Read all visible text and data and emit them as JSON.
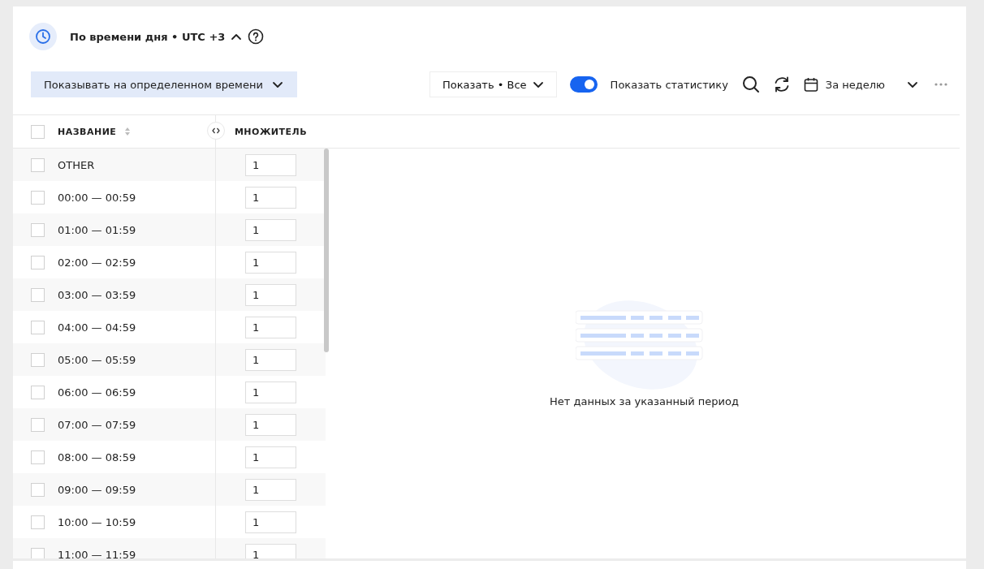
{
  "header": {
    "title": "По времени дня • UTC +3",
    "expanded": true
  },
  "toolbar": {
    "mode_button": "Показывать на определенном времени",
    "show_filter": "Показать • Все",
    "statistics_toggle": {
      "label": "Показать статистику",
      "on": true
    },
    "period": "За неделю"
  },
  "table": {
    "columns": [
      "НАЗВАНИЕ",
      "МНОЖИТЕЛЬ"
    ],
    "select_all": {
      "checked": false
    },
    "rows": [
      {
        "name": "OTHER",
        "multiplier": "1",
        "checked": false
      },
      {
        "name": "00:00 — 00:59",
        "multiplier": "1",
        "checked": false
      },
      {
        "name": "01:00 — 01:59",
        "multiplier": "1",
        "checked": false
      },
      {
        "name": "02:00 — 02:59",
        "multiplier": "1",
        "checked": false
      },
      {
        "name": "03:00 — 03:59",
        "multiplier": "1",
        "checked": false
      },
      {
        "name": "04:00 — 04:59",
        "multiplier": "1",
        "checked": false
      },
      {
        "name": "05:00 — 05:59",
        "multiplier": "1",
        "checked": false
      },
      {
        "name": "06:00 — 06:59",
        "multiplier": "1",
        "checked": false
      },
      {
        "name": "07:00 — 07:59",
        "multiplier": "1",
        "checked": false
      },
      {
        "name": "08:00 — 08:59",
        "multiplier": "1",
        "checked": false
      },
      {
        "name": "09:00 — 09:59",
        "multiplier": "1",
        "checked": false
      },
      {
        "name": "10:00 — 10:59",
        "multiplier": "1",
        "checked": false
      },
      {
        "name": "11:00 — 11:59",
        "multiplier": "1",
        "checked": false
      }
    ]
  },
  "empty_state": {
    "message": "Нет данных за указанный период"
  }
}
